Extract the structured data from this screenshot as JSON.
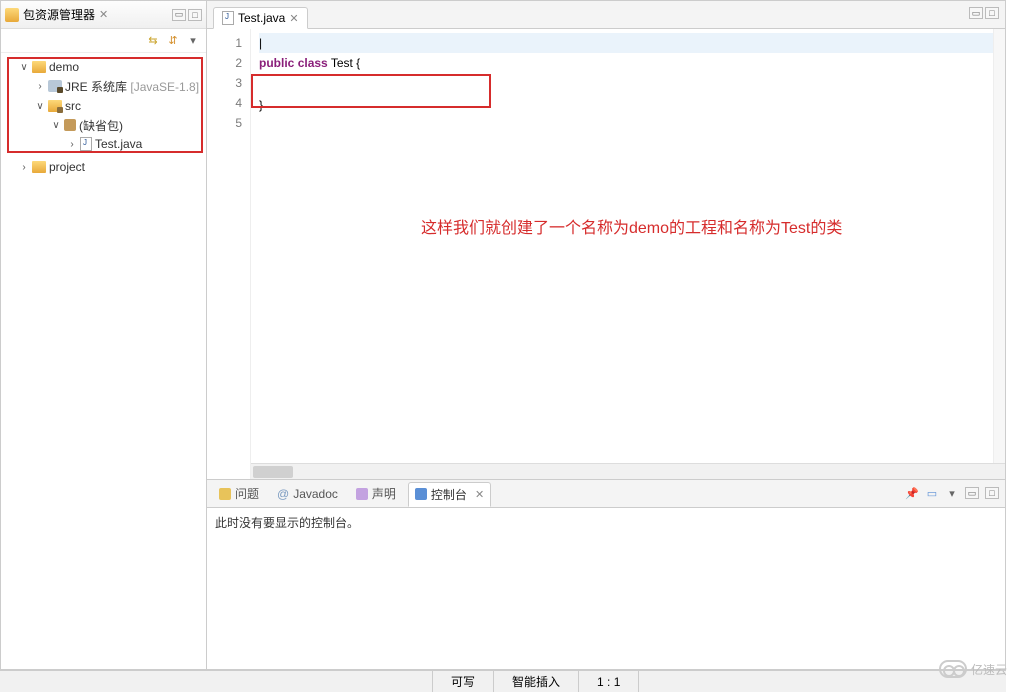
{
  "package_explorer": {
    "title": "包资源管理器",
    "tree": {
      "demo": {
        "label": "demo",
        "jre": {
          "label": "JRE 系统库",
          "suffix": "[JavaSE-1.8]"
        },
        "src": {
          "label": "src",
          "default_pkg": {
            "label": "(缺省包)"
          },
          "file": {
            "label": "Test.java"
          }
        }
      },
      "project": {
        "label": "project"
      }
    }
  },
  "editor": {
    "tab_label": "Test.java",
    "code_lines": [
      "",
      "public class Test {",
      "",
      "}",
      ""
    ],
    "line_numbers": [
      "1",
      "2",
      "3",
      "4",
      "5"
    ]
  },
  "annotation": "这样我们就创建了一个名称为demo的工程和名称为Test的类",
  "bottom": {
    "tabs": {
      "problems": "问题",
      "javadoc": "Javadoc",
      "declaration": "声明",
      "console": "控制台"
    },
    "console_msg": "此时没有要显示的控制台。"
  },
  "status": {
    "writable": "可写",
    "insert": "智能插入",
    "position": "1 : 1"
  },
  "watermark": "亿速云"
}
